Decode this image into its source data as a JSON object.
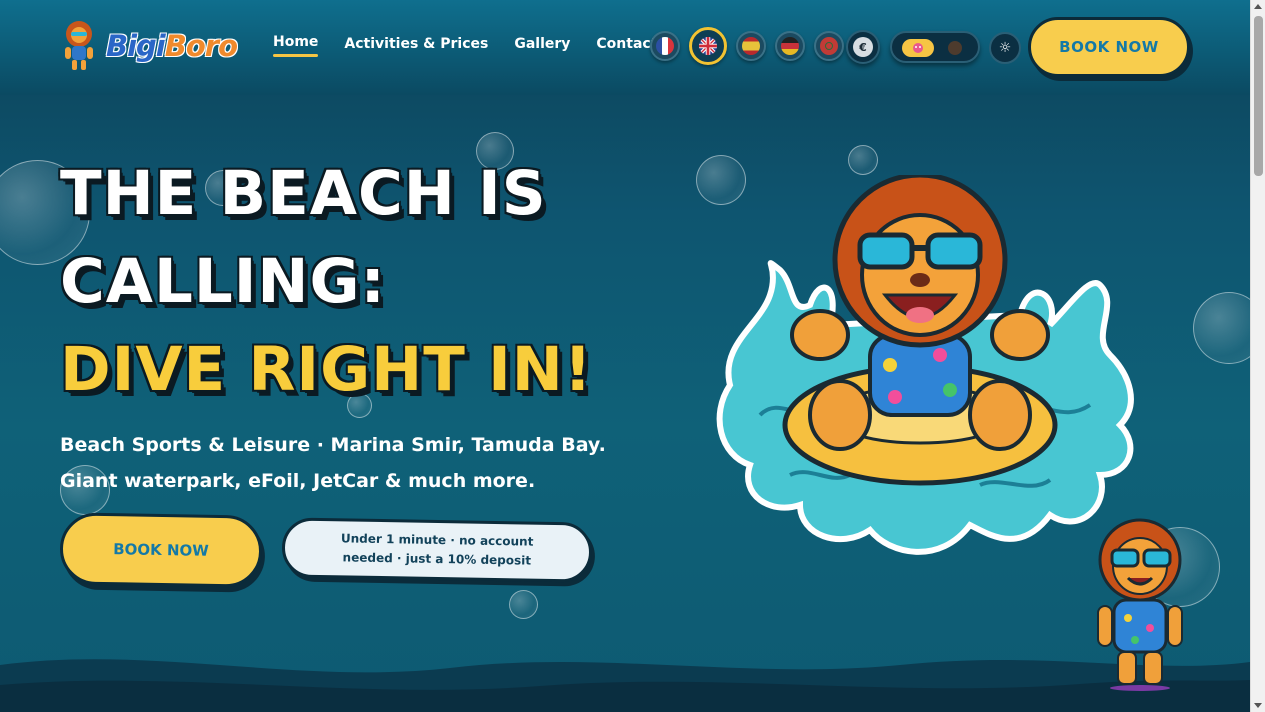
{
  "header": {
    "logo": {
      "part1": "Bigi",
      "part2": "Boro"
    },
    "nav": [
      {
        "label": "Home",
        "active": true
      },
      {
        "label": "Activities & Prices"
      },
      {
        "label": "Gallery"
      },
      {
        "label": "Contact"
      }
    ],
    "languages": [
      "fr-flag-icon",
      "uk-flag-icon",
      "es-flag-icon",
      "de-flag-icon",
      "other-flag-icon"
    ],
    "currency_symbol": "€",
    "book_label": "BOOK NOW"
  },
  "hero": {
    "title_line1": "THE BEACH IS",
    "title_line2": "CALLING:",
    "title_line3": "DIVE RIGHT IN!",
    "subtitle_line1": "Beach Sports & Leisure · Marina Smir, Tamuda Bay.",
    "subtitle_line2": "Giant waterpark, eFoil, JetCar & much more.",
    "book_label": "BOOK NOW",
    "note": "Under 1 minute · no account needed · just a 10% deposit"
  },
  "colors": {
    "accent_yellow": "#f8cd4d",
    "link_blue": "#1479a7",
    "background": "#0f6178"
  }
}
